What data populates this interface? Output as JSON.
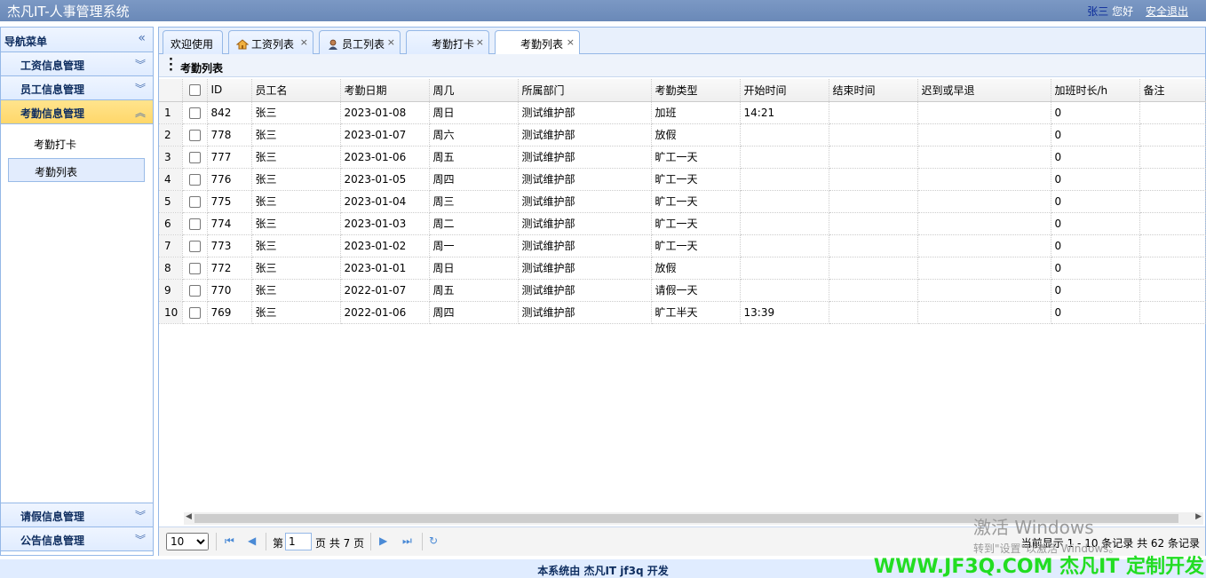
{
  "app_title": "杰凡IT-人事管理系统",
  "user": {
    "name": "张三",
    "greeting": "您好",
    "logout": "安全退出"
  },
  "sidebar": {
    "title": "导航菜单",
    "sections": [
      {
        "label": "工资信息管理"
      },
      {
        "label": "员工信息管理"
      },
      {
        "label": "考勤信息管理",
        "items": [
          {
            "label": "考勤打卡"
          },
          {
            "label": "考勤列表"
          }
        ]
      },
      {
        "label": "请假信息管理"
      },
      {
        "label": "公告信息管理"
      }
    ]
  },
  "tabs": [
    {
      "label": "欢迎使用"
    },
    {
      "label": "工资列表",
      "icon": "home-icon"
    },
    {
      "label": "员工列表",
      "icon": "person-icon"
    },
    {
      "label": "考勤打卡"
    },
    {
      "label": "考勤列表"
    }
  ],
  "panel_title": "考勤列表",
  "table": {
    "headers": [
      "ID",
      "员工名",
      "考勤日期",
      "周几",
      "所属部门",
      "考勤类型",
      "开始时间",
      "结束时间",
      "迟到或早退",
      "加班时长/h",
      "备注"
    ],
    "rows": [
      [
        "842",
        "张三",
        "2023-01-08",
        "周日",
        "测试维护部",
        "加班",
        "14:21",
        "",
        "",
        "0",
        ""
      ],
      [
        "778",
        "张三",
        "2023-01-07",
        "周六",
        "测试维护部",
        "放假",
        "",
        "",
        "",
        "0",
        ""
      ],
      [
        "777",
        "张三",
        "2023-01-06",
        "周五",
        "测试维护部",
        "旷工一天",
        "",
        "",
        "",
        "0",
        ""
      ],
      [
        "776",
        "张三",
        "2023-01-05",
        "周四",
        "测试维护部",
        "旷工一天",
        "",
        "",
        "",
        "0",
        ""
      ],
      [
        "775",
        "张三",
        "2023-01-04",
        "周三",
        "测试维护部",
        "旷工一天",
        "",
        "",
        "",
        "0",
        ""
      ],
      [
        "774",
        "张三",
        "2023-01-03",
        "周二",
        "测试维护部",
        "旷工一天",
        "",
        "",
        "",
        "0",
        ""
      ],
      [
        "773",
        "张三",
        "2023-01-02",
        "周一",
        "测试维护部",
        "旷工一天",
        "",
        "",
        "",
        "0",
        ""
      ],
      [
        "772",
        "张三",
        "2023-01-01",
        "周日",
        "测试维护部",
        "放假",
        "",
        "",
        "",
        "0",
        ""
      ],
      [
        "770",
        "张三",
        "2022-01-07",
        "周五",
        "测试维护部",
        "请假一天",
        "",
        "",
        "",
        "0",
        ""
      ],
      [
        "769",
        "张三",
        "2022-01-06",
        "周四",
        "测试维护部",
        "旷工半天",
        "13:39",
        "",
        "",
        "0",
        ""
      ]
    ]
  },
  "pager": {
    "page_size": "10",
    "page_prefix": "第",
    "page": "1",
    "page_suffix": "页 共 7 页",
    "info": "当前显示 1 - 10 条记录 共 62 条记录"
  },
  "footer": "本系统由 杰凡IT jf3q 开发",
  "brand": "WWW.JF3Q.COM 杰凡IT  定制开发",
  "windows_activation": {
    "title": "激活 Windows",
    "subtitle": "转到\"设置\"以激活 Windows。"
  },
  "colors": {
    "header": "#6a89b8",
    "border": "#95b8e7",
    "active_section": "#ffd76a",
    "brand": "#22dd22"
  }
}
